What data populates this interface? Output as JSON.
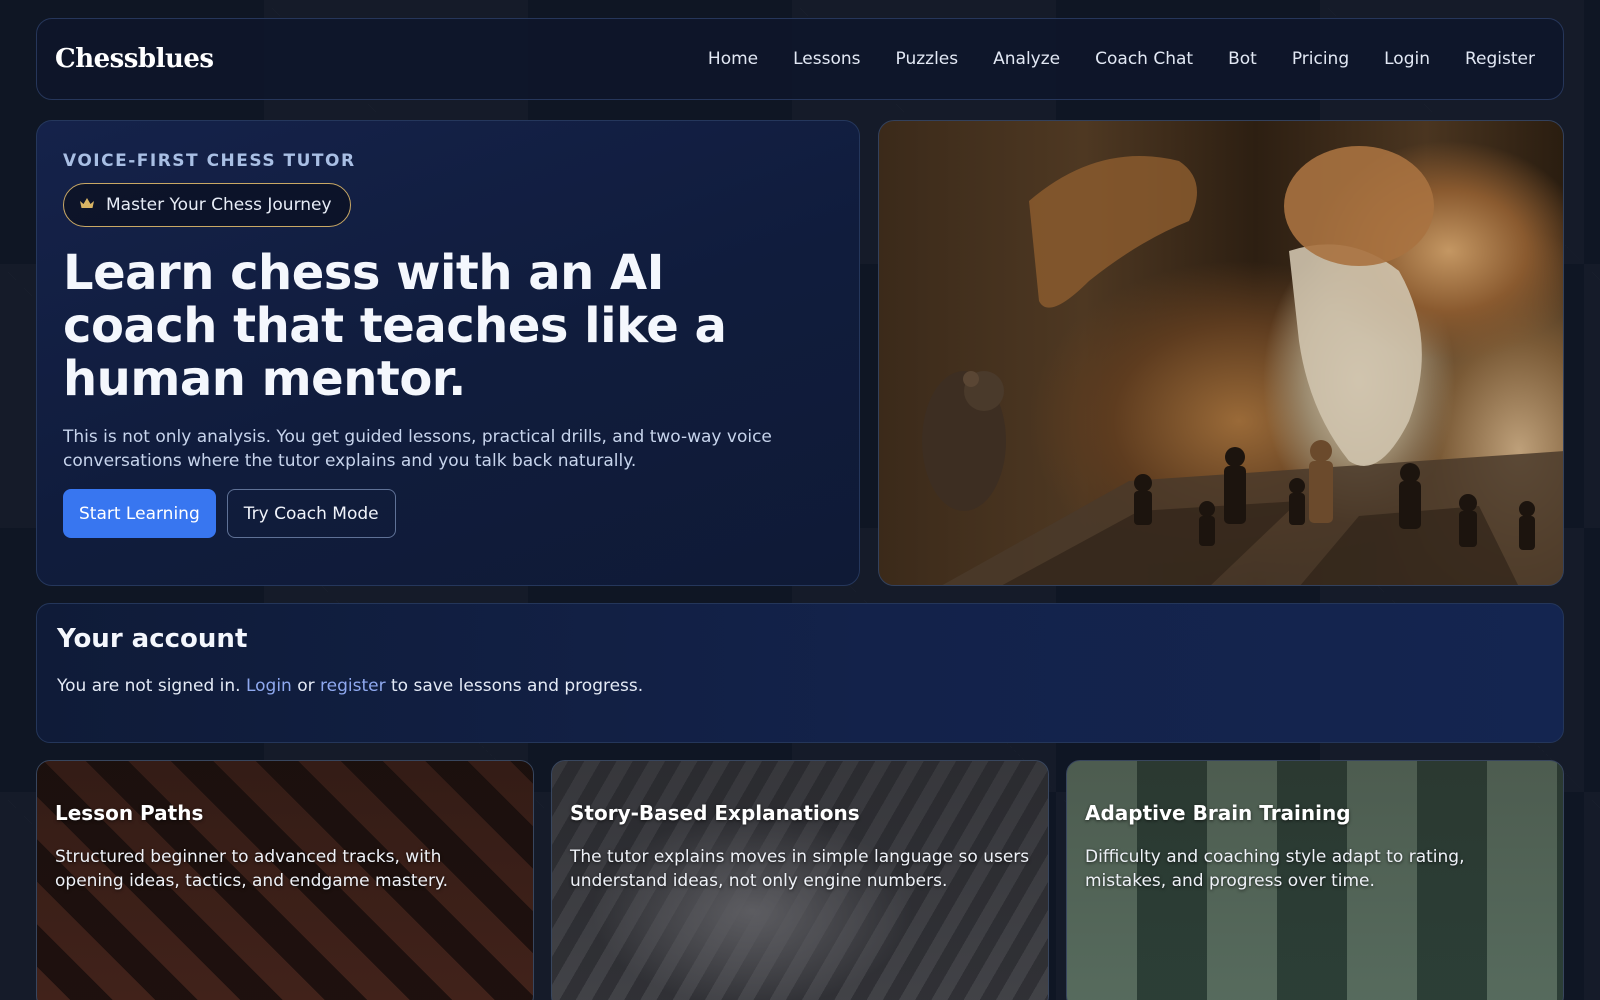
{
  "brand": "Chessblues",
  "nav": [
    "Home",
    "Lessons",
    "Puzzles",
    "Analyze",
    "Coach Chat",
    "Bot",
    "Pricing",
    "Login",
    "Register"
  ],
  "hero": {
    "eyebrow": "VOICE-FIRST CHESS TUTOR",
    "pill_icon": "crown-icon",
    "pill_label": "Master Your Chess Journey",
    "title": "Learn chess with an AI coach that teaches like a human mentor.",
    "subtitle": "This is not only analysis. You get guided lessons, practical drills, and two-way voice conversations where the tutor explains and you talk back naturally.",
    "primary_button": "Start Learning",
    "secondary_button": "Try Coach Mode"
  },
  "account": {
    "title": "Your account",
    "text_before": "You are not signed in.",
    "login_link": "Login",
    "text_or": "or",
    "register_link": "register",
    "text_after": "to save lessons and progress."
  },
  "features": [
    {
      "title": "Lesson Paths",
      "text": "Structured beginner to advanced tracks, with opening ideas, tactics, and endgame mastery."
    },
    {
      "title": "Story-Based Explanations",
      "text": "The tutor explains moves in simple language so users understand ideas, not only engine numbers."
    },
    {
      "title": "Adaptive Brain Training",
      "text": "Difficulty and coaching style adapt to rating, mistakes, and progress over time."
    }
  ],
  "colors": {
    "accent": "#3876f0",
    "link": "#8fa9ef",
    "pill_border": "#c9a864"
  }
}
